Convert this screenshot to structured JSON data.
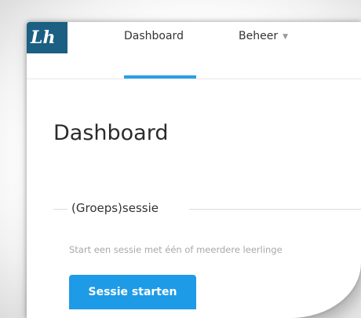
{
  "brand": {
    "logo_text": "Lh",
    "logo_color": "#1b5f82"
  },
  "nav": {
    "items": [
      {
        "label": "Dashboard",
        "active": true
      },
      {
        "label": "Beheer",
        "has_dropdown": true
      }
    ],
    "accent": "#2b9fe6"
  },
  "page": {
    "title": "Dashboard"
  },
  "session": {
    "title": "(Groeps)sessie",
    "description": "Start een sessie met één of meerdere leerlinge",
    "button_label": "Sessie starten",
    "button_color": "#1e9be6"
  }
}
